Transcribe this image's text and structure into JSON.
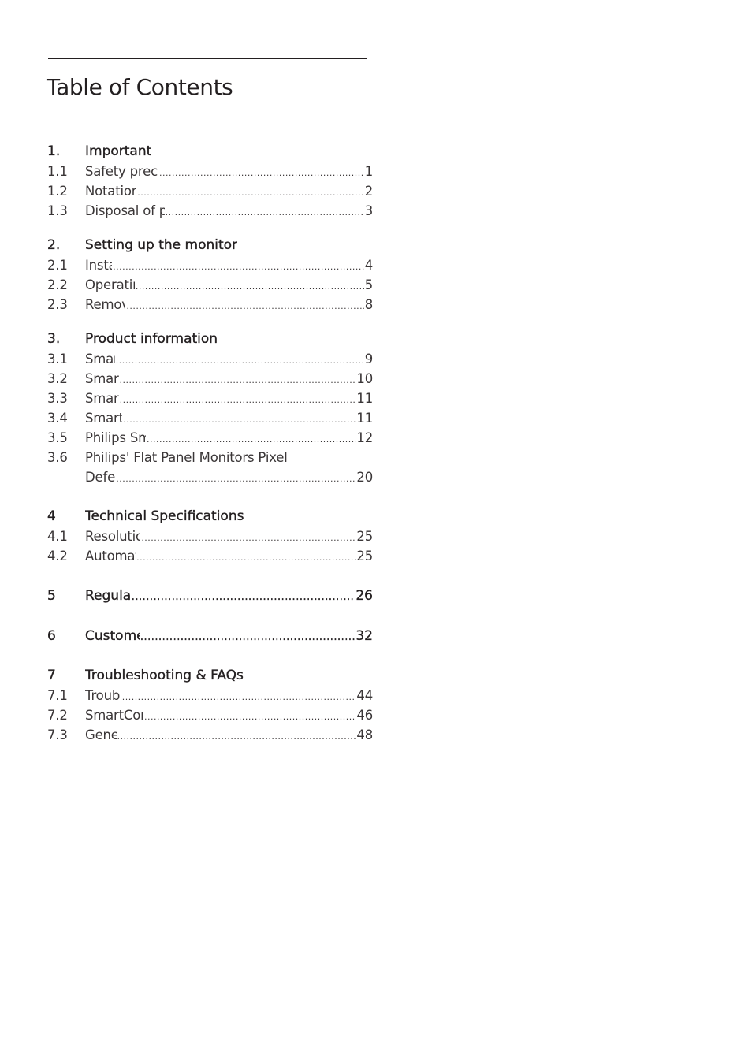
{
  "document": {
    "title": "Table of Contents",
    "sections": [
      {
        "number": "1.",
        "title": "Important",
        "page": null,
        "items": [
          {
            "number": "1.1",
            "title": "Safety precautions and maintenance",
            "page": "1"
          },
          {
            "number": "1.2",
            "title": "Notational Descriptions",
            "page": "2"
          },
          {
            "number": "1.3",
            "title": "Disposal of product and packing material",
            "page": "3"
          }
        ]
      },
      {
        "number": "2.",
        "title": "Setting up the monitor",
        "page": null,
        "items": [
          {
            "number": "2.1",
            "title": "Installation",
            "page": "4"
          },
          {
            "number": "2.2",
            "title": "Operating the monitor",
            "page": "5"
          },
          {
            "number": "2.3",
            "title": "Remove the Base",
            "page": "8"
          }
        ]
      },
      {
        "number": "3.",
        "title": "Product information",
        "page": null,
        "items": [
          {
            "number": "3.1",
            "title": "SmartImage",
            "page": "9"
          },
          {
            "number": "3.2",
            "title": "SmartContrast",
            "page": "10"
          },
          {
            "number": "3.3",
            "title": "SmartSaturate",
            "page": "11"
          },
          {
            "number": "3.4",
            "title": "SmartSharpness",
            "page": "11"
          },
          {
            "number": "3.5",
            "title": "Philips SmartControl Premium",
            "page": "12"
          },
          {
            "number": "3.6",
            "title": "Philips' Flat Panel Monitors Pixel",
            "title_cont": "Defect Policy",
            "page": "20"
          }
        ]
      },
      {
        "number": "4",
        "title": "Technical Specifications",
        "page": null,
        "items": [
          {
            "number": "4.1",
            "title": "Resolution & Preset Modes",
            "page": "25"
          },
          {
            "number": "4.2",
            "title": "Automatic PowerSaving",
            "page": "25"
          }
        ]
      },
      {
        "number": "5",
        "title": "Regulatory Information",
        "page": "26",
        "items": []
      },
      {
        "number": "6",
        "title": "Customer care and warranty",
        "page": "32",
        "items": []
      },
      {
        "number": "7",
        "title": "Troubleshooting & FAQs",
        "page": null,
        "items": [
          {
            "number": "7.1",
            "title": "Troubleshooting",
            "page": "44"
          },
          {
            "number": "7.2",
            "title": "SmartControl Premium FAQs",
            "page": "46"
          },
          {
            "number": "7.3",
            "title": "General FAQs",
            "page": "48"
          }
        ]
      }
    ]
  }
}
